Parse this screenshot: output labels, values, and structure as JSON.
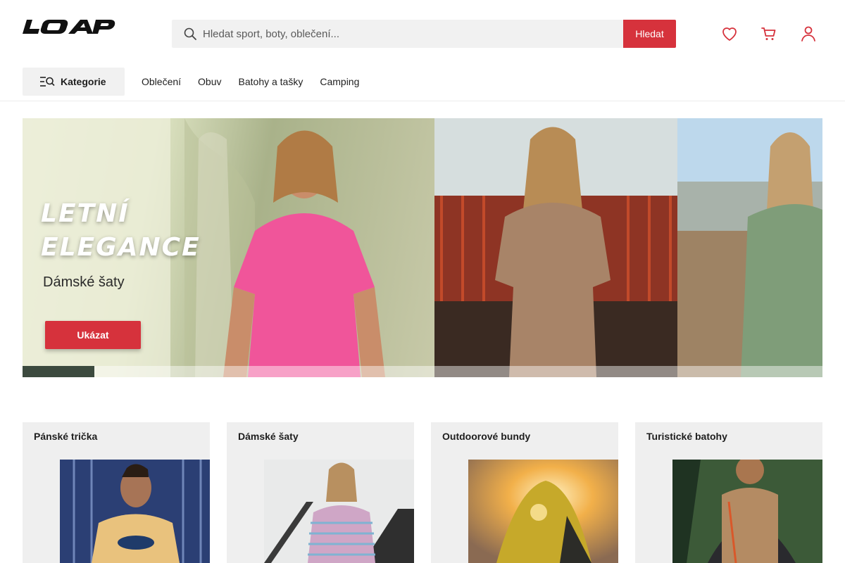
{
  "header": {
    "logo_text": "LOAP",
    "search": {
      "placeholder": "Hledat sport, boty, oblečení...",
      "button_label": "Hledat"
    },
    "icons": [
      "heart-icon",
      "cart-icon",
      "user-icon"
    ]
  },
  "nav": {
    "categories_label": "Kategorie",
    "links": [
      "Oblečení",
      "Obuv",
      "Batohy a tašky",
      "Camping"
    ]
  },
  "hero": {
    "title_line1": "Letní",
    "title_line2": "elegance",
    "subtitle": "Dámské šaty",
    "cta_label": "Ukázat",
    "slide_progress_fraction": 0.09
  },
  "categories": [
    {
      "title": "Pánské trička"
    },
    {
      "title": "Dámské šaty"
    },
    {
      "title": "Outdoorové bundy"
    },
    {
      "title": "Turistické batohy"
    }
  ],
  "colors": {
    "accent": "#d6323c",
    "panel_bg": "#f1f1f1",
    "text": "#1e1e1e"
  }
}
